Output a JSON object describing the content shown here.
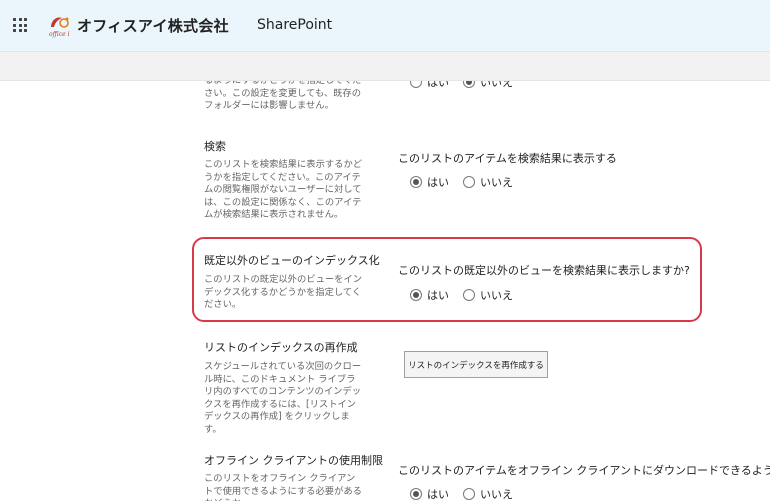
{
  "header": {
    "company": "オフィスアイ株式会社",
    "app_name": "SharePoint",
    "logo_text": "office i"
  },
  "sections": {
    "partial": {
      "desc": "るようにするかどうかを指定してください。この設定を変更しても、既存のフォルダーには影響しません。",
      "yes": "はい",
      "no": "いいえ",
      "selected": "no"
    },
    "search": {
      "title": "検索",
      "desc": "このリストを検索結果に表示するかどうかを指定してください。このアイテムの閲覧権限がないユーザーに対しては、この設定に関係なく、このアイテムが検索結果に表示されません。",
      "question": "このリストのアイテムを検索結果に表示する",
      "yes": "はい",
      "no": "いいえ",
      "selected": "yes"
    },
    "nondefault_views": {
      "title": "既定以外のビューのインデックス化",
      "desc": "このリストの既定以外のビューをインデックス化するかどうかを指定してください。",
      "question": "このリストの既定以外のビューを検索結果に表示しますか?",
      "yes": "はい",
      "no": "いいえ",
      "selected": "yes"
    },
    "reindex": {
      "title": "リストのインデックスの再作成",
      "desc": "スケジュールされている次回のクロール時に、このドキュメント ライブラリ内のすべてのコンテンツのインデックスを再作成するには、[リストインデックスの再作成] をクリックします。",
      "button": "リストのインデックスを再作成する"
    },
    "offline": {
      "title": "オフライン クライアントの使用制限",
      "desc": "このリストをオフライン クライアントで使用できるようにする必要があるかどうか",
      "question": "このリストのアイテムをオフライン クライアントにダウンロードできるようにする",
      "yes": "はい",
      "no": "いいえ",
      "selected": "yes"
    }
  },
  "colors": {
    "topbar": "#eaf6fb",
    "highlight": "#d93a4a",
    "commandbar": "#f2f2f2"
  }
}
